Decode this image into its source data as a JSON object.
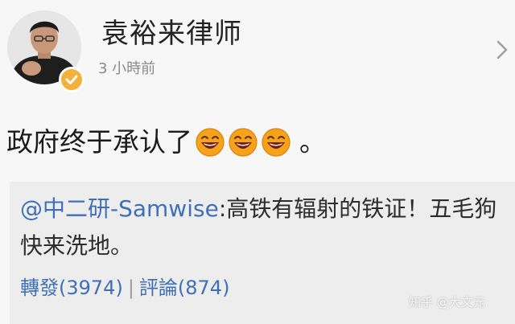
{
  "post": {
    "author": {
      "name": "袁裕来律师",
      "verified": true
    },
    "timestamp": "3 小時前",
    "text": "政府终于承认了",
    "emoji_count": 3,
    "emoji_icon": "laughing-emoji-icon",
    "text_end": "。"
  },
  "quote": {
    "author": "@中二研-Samwise",
    "separator": ":",
    "text": "高铁有辐射的铁证！五毛狗快来洗地。",
    "actions": {
      "repost_label": "轉發(3974)",
      "divider": "|",
      "comment_label": "評論(874)"
    }
  },
  "watermark": "知乎 @大文元",
  "colors": {
    "link": "#3f6fb8",
    "badge": "#f2b13a",
    "quote_bg": "#ededed",
    "page_bg": "#f7f7f7"
  }
}
